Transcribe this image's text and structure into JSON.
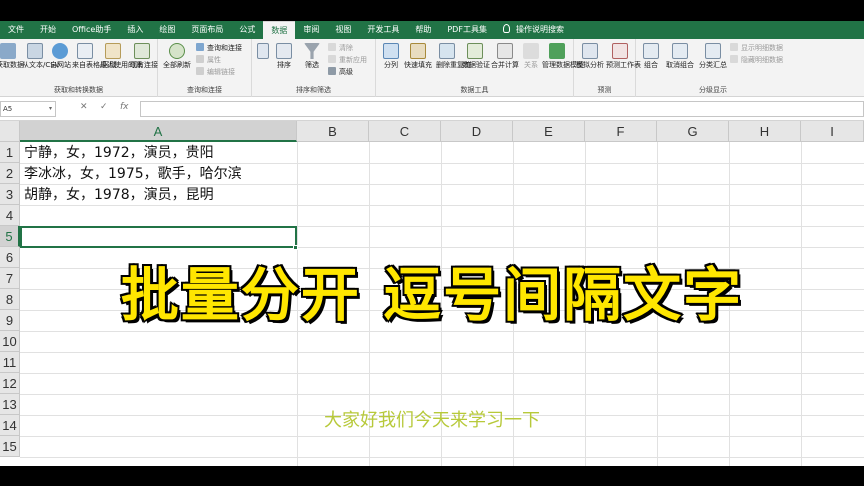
{
  "ribbon": {
    "tabs": [
      "文件",
      "开始",
      "Office助手",
      "插入",
      "绘图",
      "页面布局",
      "公式",
      "数据",
      "审阅",
      "视图",
      "开发工具",
      "帮助",
      "PDF工具集",
      "操作说明搜索"
    ],
    "active_tab": "数据",
    "groups": {
      "get_transform": {
        "label": "获取和转换数据",
        "buttons": [
          "获取数据",
          "从文本/CSV",
          "自网站",
          "来自表格/区域",
          "最近使用的源",
          "现有连接"
        ]
      },
      "queries": {
        "label": "查询和连接",
        "refresh_all": "全部刷新",
        "items": [
          "查询和连接",
          "属性",
          "编辑链接"
        ]
      },
      "sort_filter": {
        "label": "排序和筛选",
        "sort": "排序",
        "filter": "筛选",
        "items": [
          "清除",
          "重新应用",
          "高级"
        ]
      },
      "data_tools": {
        "label": "数据工具",
        "buttons": [
          "分列",
          "快速填充",
          "删除重复值",
          "数据验证",
          "合并计算",
          "关系",
          "管理数据模型"
        ]
      },
      "forecast": {
        "label": "预测",
        "buttons": [
          "模拟分析",
          "预测工作表"
        ]
      },
      "outline": {
        "label": "分级显示",
        "buttons": [
          "组合",
          "取消组合",
          "分类汇总"
        ],
        "items": [
          "显示明细数据",
          "隐藏明细数据"
        ]
      }
    }
  },
  "formula_bar": {
    "name_box": "A5",
    "cancel_glyph": "✕",
    "enter_glyph": "✓",
    "fx_label": "fx",
    "formula": ""
  },
  "sheet": {
    "columns": [
      "A",
      "B",
      "C",
      "D",
      "E",
      "F",
      "G",
      "H",
      "I"
    ],
    "rows": [
      "1",
      "2",
      "3",
      "4",
      "5",
      "6",
      "7",
      "8",
      "9",
      "10",
      "11",
      "12",
      "13",
      "14",
      "15"
    ],
    "cells": {
      "A1": "宁静，女，1972，演员，贵阳",
      "A2": "李冰冰，女，1975，歌手，哈尔滨",
      "A3": "胡静，女，1978，演员，昆明"
    },
    "selected_cell": "A5"
  },
  "overlay": {
    "title": "批量分开 逗号间隔文字",
    "subtitle": "大家好我们今天来学习一下",
    "title_color": "#ffe600",
    "subtitle_color": "#b7c93a"
  },
  "colors": {
    "excel_green": "#217346",
    "ribbon_bg": "#f3f3f3"
  }
}
